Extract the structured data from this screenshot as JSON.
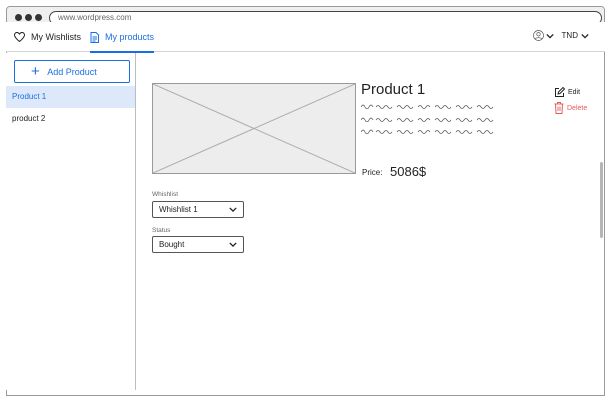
{
  "browser": {
    "url": "www.wordpress.com"
  },
  "header": {
    "tabs": [
      {
        "label": "My Wishlists",
        "icon": "heart-icon"
      },
      {
        "label": "My products",
        "icon": "document-icon",
        "active": true
      }
    ],
    "currency": "TND"
  },
  "sidebar": {
    "add_label": "Add Product",
    "items": [
      {
        "label": "Product 1",
        "selected": true
      },
      {
        "label": "product 2"
      }
    ]
  },
  "product": {
    "title": "Product 1",
    "price_label": "Price:",
    "price": "5086$",
    "edit_label": "Edit",
    "delete_label": "Delete"
  },
  "fields": {
    "wishlist_label": "Whishlist",
    "wishlist_value": "Whishlist 1",
    "status_label": "Status",
    "status_value": "Bought"
  },
  "colors": {
    "accent": "#1a6fe0",
    "danger": "#e85b5b",
    "selected_bg": "#dde9fb"
  }
}
